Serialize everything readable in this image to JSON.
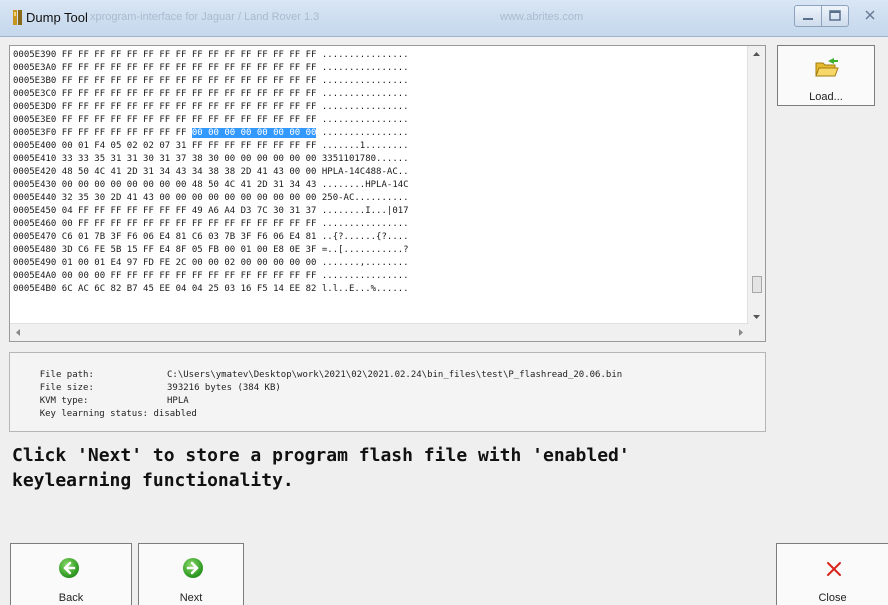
{
  "window": {
    "title": "Dump Tool",
    "title_faded": "xprogram-interface for Jaguar / Land Rover 1.3",
    "title_url": "www.abrites.com"
  },
  "hex": {
    "lines": [
      {
        "addr": "0005E390",
        "bytes": "FF FF FF FF FF FF FF FF FF FF FF FF FF FF FF FF",
        "ascii": "................"
      },
      {
        "addr": "0005E3A0",
        "bytes": "FF FF FF FF FF FF FF FF FF FF FF FF FF FF FF FF",
        "ascii": "................"
      },
      {
        "addr": "0005E3B0",
        "bytes": "FF FF FF FF FF FF FF FF FF FF FF FF FF FF FF FF",
        "ascii": "................"
      },
      {
        "addr": "0005E3C0",
        "bytes": "FF FF FF FF FF FF FF FF FF FF FF FF FF FF FF FF",
        "ascii": "................"
      },
      {
        "addr": "0005E3D0",
        "bytes": "FF FF FF FF FF FF FF FF FF FF FF FF FF FF FF FF",
        "ascii": "................"
      },
      {
        "addr": "0005E3E0",
        "bytes": "FF FF FF FF FF FF FF FF FF FF FF FF FF FF FF FF",
        "ascii": "................"
      },
      {
        "addr": "0005E3F0",
        "bytes_pre": "FF FF FF FF FF FF FF FF ",
        "bytes": "00 00 00 00 00 00 00 00",
        "ascii": "................"
      },
      {
        "addr": "0005E400",
        "bytes": "00 01 F4 05 02 02 07 31 FF FF FF FF FF FF FF FF",
        "ascii": ".......1........"
      },
      {
        "addr": "0005E410",
        "bytes": "33 33 35 31 31 30 31 37 38 30 00 00 00 00 00 00",
        "ascii": "3351101780......"
      },
      {
        "addr": "0005E420",
        "bytes": "48 50 4C 41 2D 31 34 43 34 38 38 2D 41 43 00 00",
        "ascii": "HPLA-14C488-AC.."
      },
      {
        "addr": "0005E430",
        "bytes": "00 00 00 00 00 00 00 00 48 50 4C 41 2D 31 34 43",
        "ascii": "........HPLA-14C"
      },
      {
        "addr": "0005E440",
        "bytes": "32 35 30 2D 41 43 00 00 00 00 00 00 00 00 00 00",
        "ascii": "250-AC.........."
      },
      {
        "addr": "0005E450",
        "bytes": "04 FF FF FF FF FF FF FF 49 A6 A4 D3 7C 30 31 37",
        "ascii": "........I...|017"
      },
      {
        "addr": "0005E460",
        "bytes": "00 FF FF FF FF FF FF FF FF FF FF FF FF FF FF FF",
        "ascii": "................"
      },
      {
        "addr": "0005E470",
        "bytes": "C6 01 7B 3F F6 06 E4 81 C6 03 7B 3F F6 06 E4 81",
        "ascii": "..{?......{?...."
      },
      {
        "addr": "0005E480",
        "bytes": "3D C6 FE 5B 15 FF E4 8F 05 FB 00 01 00 E8 0E 3F",
        "ascii": "=..[...........?"
      },
      {
        "addr": "0005E490",
        "bytes": "01 00 01 E4 97 FD FE 2C 00 00 02 00 00 00 00 00",
        "ascii": ".......,........"
      },
      {
        "addr": "0005E4A0",
        "bytes": "00 00 00 FF FF FF FF FF FF FF FF FF FF FF FF FF",
        "ascii": "................"
      },
      {
        "addr": "0005E4B0",
        "bytes": "6C AC 6C 82 B7 45 EE 04 04 25 03 16 F5 14 EE 82",
        "ascii": "l.l..E...%......"
      }
    ]
  },
  "info": {
    "file_path_label": "File path:",
    "file_path": "C:\\Users\\ymatev\\Desktop\\work\\2021\\02\\2021.02.24\\bin_files\\test\\P_flashread_20.06.bin",
    "file_size_label": "File size:",
    "file_size": "393216 bytes (384 KB)",
    "kvm_type_label": "KVM type:",
    "kvm_type": "HPLA",
    "key_learning_label": "Key learning status:",
    "key_learning": "disabled"
  },
  "message": "Click 'Next' to store a program flash file with 'enabled'\nkeylearning functionality.",
  "buttons": {
    "load": "Load...",
    "back": "Back",
    "next": "Next",
    "close": "Close"
  },
  "colors": {
    "selection": "#3399ff",
    "nav_green": "#2f9a23",
    "close_red": "#d9241c"
  }
}
